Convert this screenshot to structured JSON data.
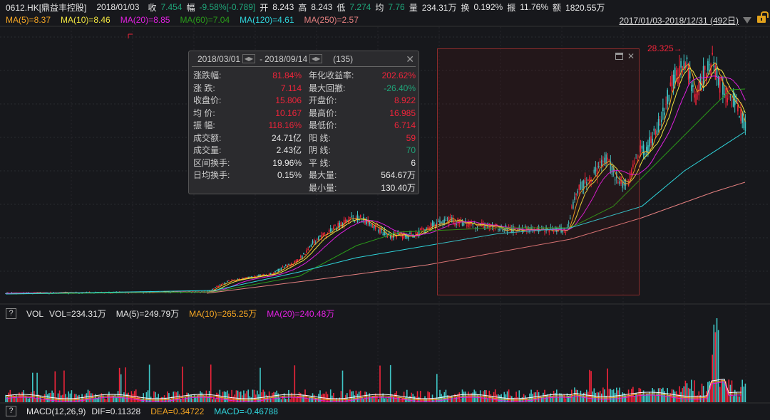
{
  "header": {
    "symbol": "0612.HK[鼎益丰控股]",
    "date": "2018/01/03",
    "close_label": "收",
    "close": "7.454",
    "change_label": "幅",
    "change": "-9.58%[-0.789]",
    "open_label": "开",
    "open": "8.243",
    "high_label": "高",
    "high": "8.243",
    "low_label": "低",
    "low": "7.274",
    "avg_label": "均",
    "avg": "7.76",
    "vol_label": "量",
    "vol": "234.31万",
    "turnover_label": "换",
    "turnover": "0.192%",
    "amp_label": "振",
    "amp": "11.76%",
    "amount_label": "额",
    "amount": "1820.55万"
  },
  "ma": {
    "ma5": "MA(5)=8.37",
    "ma10": "MA(10)=8.46",
    "ma20": "MA(20)=8.85",
    "ma60": "MA(60)=7.04",
    "ma120": "MA(120)=4.61",
    "ma250": "MA(250)=2.57"
  },
  "range": "2017/01/03-2018/12/31 (492日)",
  "peak_label": "28.325",
  "colors": {
    "up": "#f0243a",
    "down": "#3fc6c6",
    "ma5": "#f5a623",
    "ma10": "#f2e640",
    "ma20": "#e020e0",
    "ma60": "#2a9c1a",
    "ma120": "#2fd5dc",
    "ma250": "#e58080"
  },
  "popup": {
    "start": "2018/03/01",
    "sep": "-",
    "end": "2018/09/14",
    "count": "(135)",
    "left": [
      {
        "k": "涨跌幅:",
        "v": "81.84%",
        "c": "r"
      },
      {
        "k": "涨  跌:",
        "v": "7.114",
        "c": "r"
      },
      {
        "k": "收盘价:",
        "v": "15.806",
        "c": "r"
      },
      {
        "k": "均  价:",
        "v": "10.167",
        "c": "r"
      },
      {
        "k": "振  幅:",
        "v": "118.16%",
        "c": "r"
      },
      {
        "k": "成交额:",
        "v": "24.71亿",
        "c": "w"
      },
      {
        "k": "成交量:",
        "v": "2.43亿",
        "c": "w"
      },
      {
        "k": "区间换手:",
        "v": "19.96%",
        "c": "w"
      },
      {
        "k": "日均换手:",
        "v": "0.15%",
        "c": "w"
      }
    ],
    "right": [
      {
        "k": "年化收益率:",
        "v": "202.62%",
        "c": "r"
      },
      {
        "k": "最大回撤:",
        "v": "-26.40%",
        "c": "g"
      },
      {
        "k": "开盘价:",
        "v": "8.922",
        "c": "r"
      },
      {
        "k": "最高价:",
        "v": "16.985",
        "c": "r"
      },
      {
        "k": "最低价:",
        "v": "6.714",
        "c": "r"
      },
      {
        "k": "阳  线:",
        "v": "59",
        "c": "r"
      },
      {
        "k": "阴  线:",
        "v": "70",
        "c": "g"
      },
      {
        "k": "平  线:",
        "v": "6",
        "c": "w"
      },
      {
        "k": "最大量:",
        "v": "564.67万",
        "c": "w"
      },
      {
        "k": "最小量:",
        "v": "130.40万",
        "c": "w"
      }
    ]
  },
  "vol": {
    "help": "?",
    "name": "VOL",
    "vol": "VOL=234.31万",
    "ma5": "MA(5)=249.79万",
    "ma10": "MA(10)=265.25万",
    "ma20": "MA(20)=240.48万"
  },
  "macd": {
    "help": "?",
    "name": "MACD(12,26,9)",
    "dif": "DIF=0.11328",
    "dea": "DEA=0.34722",
    "macd": "MACD=-0.46788"
  }
}
